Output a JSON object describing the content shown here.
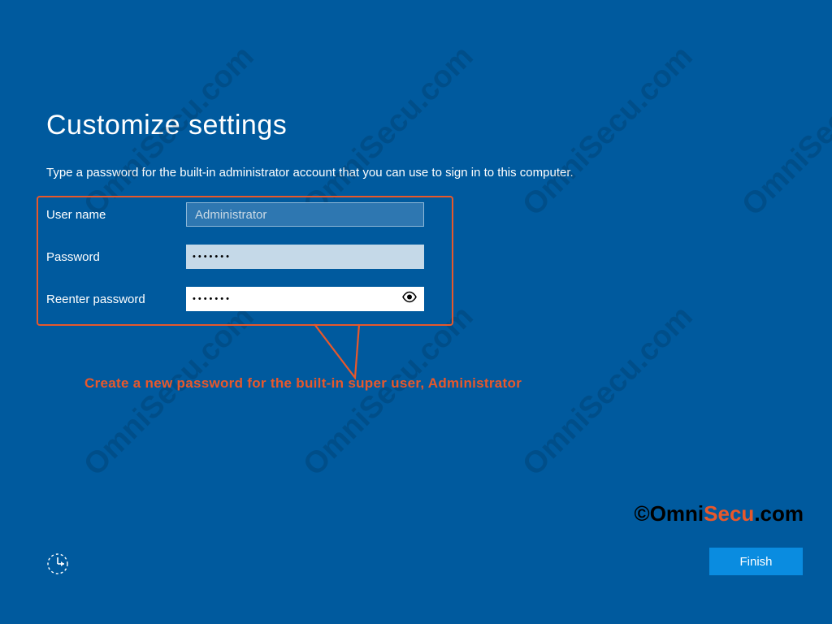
{
  "title": "Customize settings",
  "instruction": "Type a password for the built-in administrator account that you can use to sign in to this computer.",
  "form": {
    "username_label": "User name",
    "username_value": "Administrator",
    "password_label": "Password",
    "password_dots": "•••••••",
    "reenter_label": "Reenter password",
    "reenter_dots": "•••••••"
  },
  "annotation": "Create a new password for the built-in super user, Administrator",
  "finish_button": "Finish",
  "copyright": {
    "prefix": "©",
    "black1": "Omni",
    "orange": "Secu",
    "black2": ".com"
  },
  "watermark": "OmniSecu.com"
}
